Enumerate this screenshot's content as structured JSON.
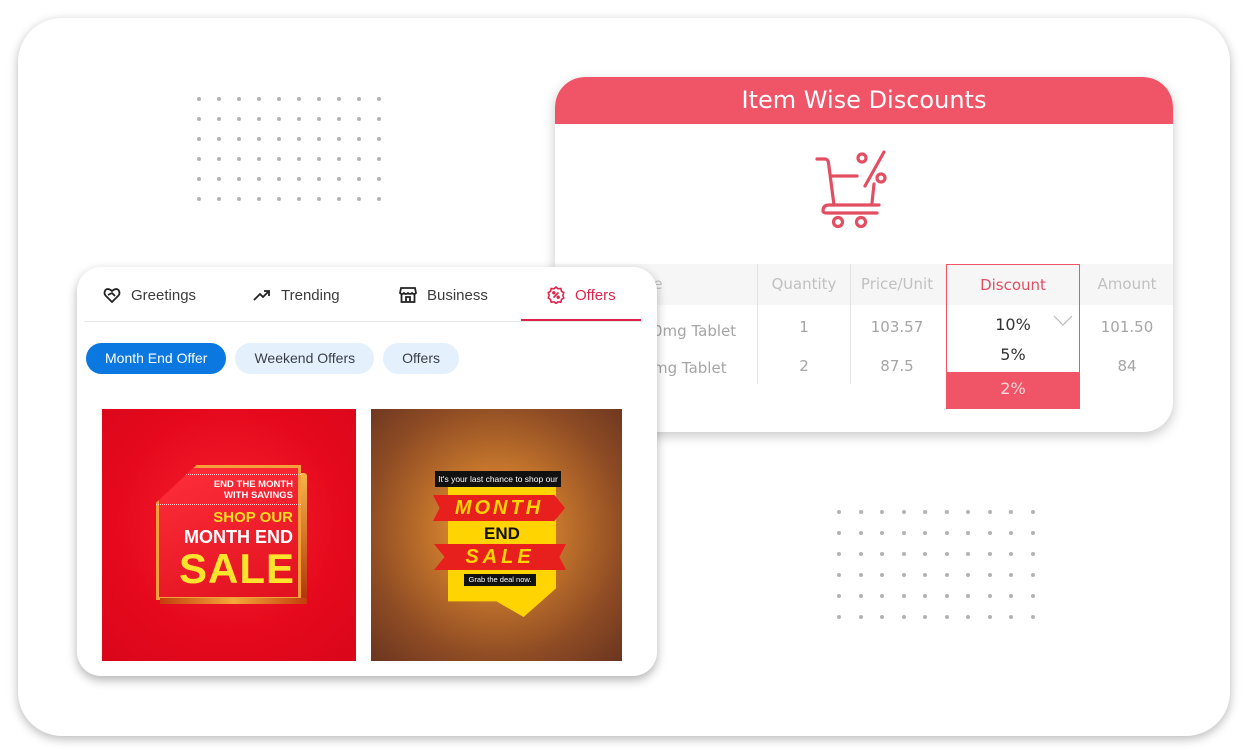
{
  "discount_card": {
    "title": "Item Wise Discounts",
    "icon": "cart-percent-icon",
    "accent_color": "#ef5566",
    "columns": [
      "e",
      "Quantity",
      "Price/Unit",
      "Discount",
      "Amount"
    ],
    "rows": [
      {
        "name": "0mg Tablet",
        "quantity": "1",
        "price": "103.57",
        "amount": "101.50"
      },
      {
        "name": "mg Tablet",
        "quantity": "2",
        "price": "87.5",
        "amount": "84"
      }
    ],
    "discount_dropdown": {
      "options": [
        "10%",
        "5%",
        "2%"
      ],
      "selected": "2%",
      "icon": "chevron-down-icon"
    }
  },
  "template_card": {
    "tabs": [
      {
        "label": "Greetings",
        "icon": "heart-hand-icon"
      },
      {
        "label": "Trending",
        "icon": "trending-up-icon"
      },
      {
        "label": "Business",
        "icon": "storefront-icon"
      },
      {
        "label": "Offers",
        "icon": "discount-badge-icon",
        "active": true
      }
    ],
    "active_color": "#e0234b",
    "chips": [
      {
        "label": "Month End Offer",
        "active": true
      },
      {
        "label": "Weekend Offers"
      },
      {
        "label": "Offers"
      }
    ],
    "chip_active_color": "#0a78e0",
    "posters": [
      {
        "line1": "END THE MONTH",
        "line2": "WITH SAVINGS",
        "line3": "SHOP OUR",
        "line4": "MONTH END",
        "line5": "SALE"
      },
      {
        "top": "It's your last chance to shop our",
        "line1": "MONTH",
        "line2": "END",
        "line3": "SALE",
        "bottom": "Grab the deal now."
      }
    ]
  }
}
